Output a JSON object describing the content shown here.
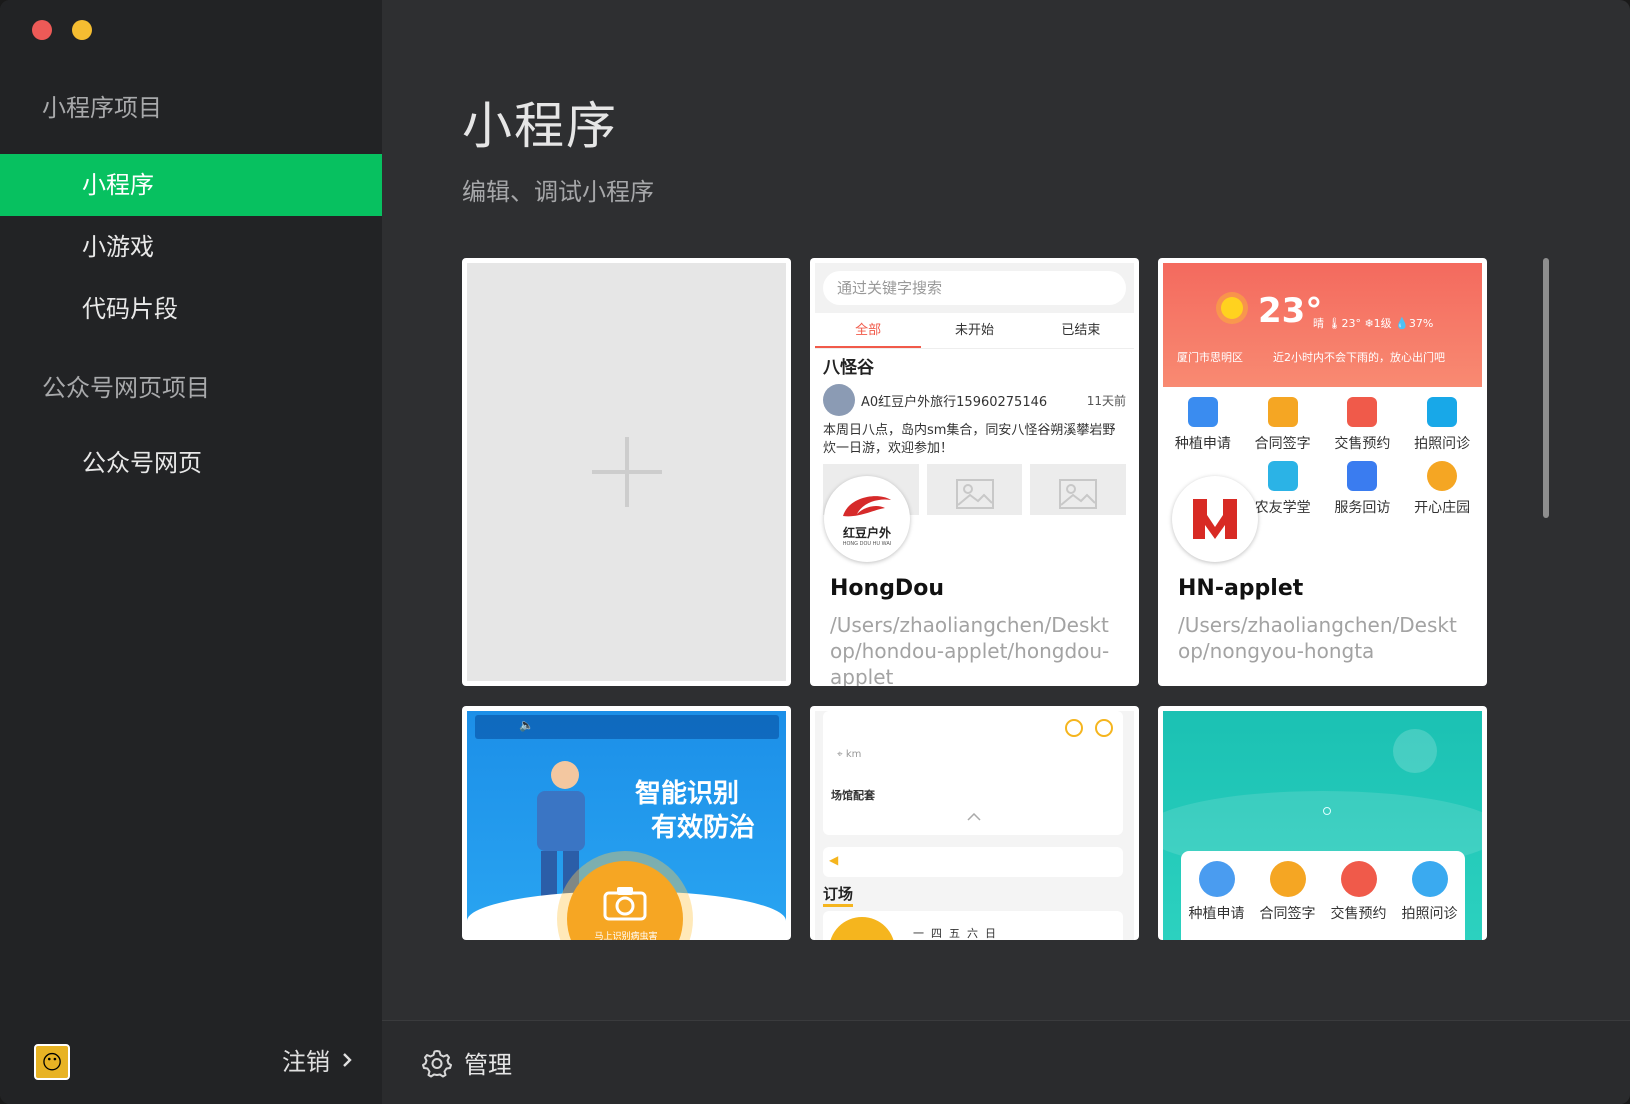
{
  "sidebar": {
    "section1": "小程序项目",
    "items1": [
      "小程序",
      "小游戏",
      "代码片段"
    ],
    "section2": "公众号网页项目",
    "items2": [
      "公众号网页"
    ],
    "logout": "注销"
  },
  "main": {
    "title": "小程序",
    "subtitle": "编辑、调试小程序"
  },
  "cards": [
    {
      "name": "HongDou",
      "path": "/Users/zhaoliangchen/Desktop/hondou-applet/hongdou-applet",
      "preview": {
        "search_placeholder": "通过关键字搜索",
        "tabs": [
          "全部",
          "未开始",
          "已结束"
        ],
        "section": "八怪谷",
        "author": "A0红豆户外旅行15960275146",
        "time": "11天前",
        "desc": "本周日八点，岛内sm集合，同安八怪谷朔溪攀岩野炊一日游，欢迎参加！",
        "logo_text": "红豆户外",
        "logo_sub": "HONG DOU HU WAI"
      }
    },
    {
      "name": "HN-applet",
      "path": "/Users/zhaoliangchen/Desktop/nongyou-hongta",
      "preview": {
        "temp": "23°",
        "weather": "晴 🌡23° ❄1级 💧37%",
        "location": "厦门市思明区",
        "tip": "近2小时内不会下雨的，放心出门吧",
        "grid": [
          "种植申请",
          "合同签字",
          "交售预约",
          "拍照问诊",
          "",
          "农友学堂",
          "服务回访",
          "开心庄园"
        ]
      }
    },
    {
      "preview": {
        "line1": "智能识别",
        "line2": "有效防治",
        "cta": "马上识别病虫害"
      }
    },
    {
      "preview": {
        "distance": "km",
        "venue": "场馆配套",
        "book": "订场",
        "week": "一  四  五  六  日"
      }
    },
    {
      "preview": {
        "grid": [
          "种植申请",
          "合同签字",
          "交售预约",
          "拍照问诊"
        ]
      }
    }
  ],
  "bottom": {
    "manage": "管理"
  },
  "colors": {
    "accent": "#07c160",
    "sidebar_bg": "#222325",
    "main_bg": "#2e2f31"
  }
}
